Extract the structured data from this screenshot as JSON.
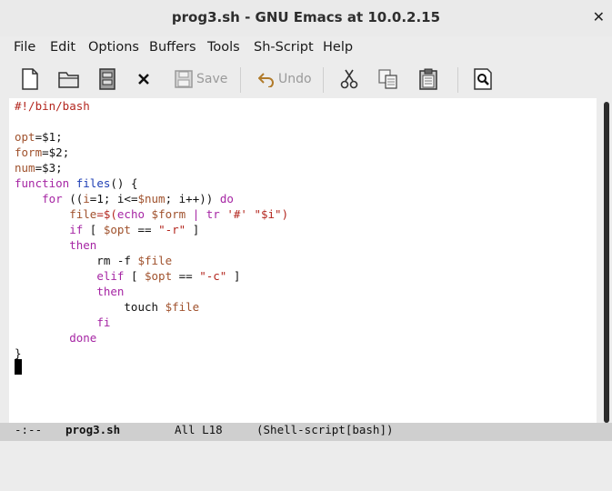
{
  "window": {
    "title": "prog3.sh - GNU Emacs at 10.0.2.15",
    "close": "✕"
  },
  "menu": [
    "File",
    "Edit",
    "Options",
    "Buffers",
    "Tools",
    "Sh-Script",
    "Help"
  ],
  "toolbar": {
    "save_label": "Save",
    "undo_label": "Undo"
  },
  "code": {
    "l1": "#!/bin/bash",
    "l3a": "opt",
    "l3b": "=",
    "l3c": "$1",
    "l3d": ";",
    "l4a": "form",
    "l4b": "=",
    "l4c": "$2",
    "l4d": ";",
    "l5a": "num",
    "l5b": "=",
    "l5c": "$3",
    "l5d": ";",
    "l6a": "function",
    "l6b": " ",
    "l6c": "files",
    "l6d": "() {",
    "l7a": "    ",
    "l7b": "for",
    "l7c": " ((",
    "l7d": "i",
    "l7e": "=1; i<=",
    "l7f": "$num",
    "l7g": "; i++)) ",
    "l7h": "do",
    "l8a": "        ",
    "l8b": "file",
    "l8c": "=$(",
    "l8d": "echo",
    "l8e": " ",
    "l8f": "$form",
    "l8g": " | tr ",
    "l8h": "'#'",
    "l8i": " ",
    "l8j": "\"$i\"",
    "l8k": ")",
    "l9a": "        ",
    "l9b": "if",
    "l9c": " [ ",
    "l9d": "$opt",
    "l9e": " == ",
    "l9f": "\"-r\"",
    "l9g": " ]",
    "l10a": "        ",
    "l10b": "then",
    "l11a": "            rm -f ",
    "l11b": "$file",
    "l12a": "            ",
    "l12b": "elif",
    "l12c": " [ ",
    "l12d": "$opt",
    "l12e": " == ",
    "l12f": "\"-c\"",
    "l12g": " ]",
    "l13a": "            ",
    "l13b": "then",
    "l14a": "                touch ",
    "l14b": "$file",
    "l15a": "            ",
    "l15b": "fi",
    "l16a": "        ",
    "l16b": "done",
    "l17": "}"
  },
  "modeline": {
    "prefix": "-:--",
    "buffer": "prog3.sh",
    "position": "All L18",
    "mode": "(Shell-script[bash])"
  }
}
